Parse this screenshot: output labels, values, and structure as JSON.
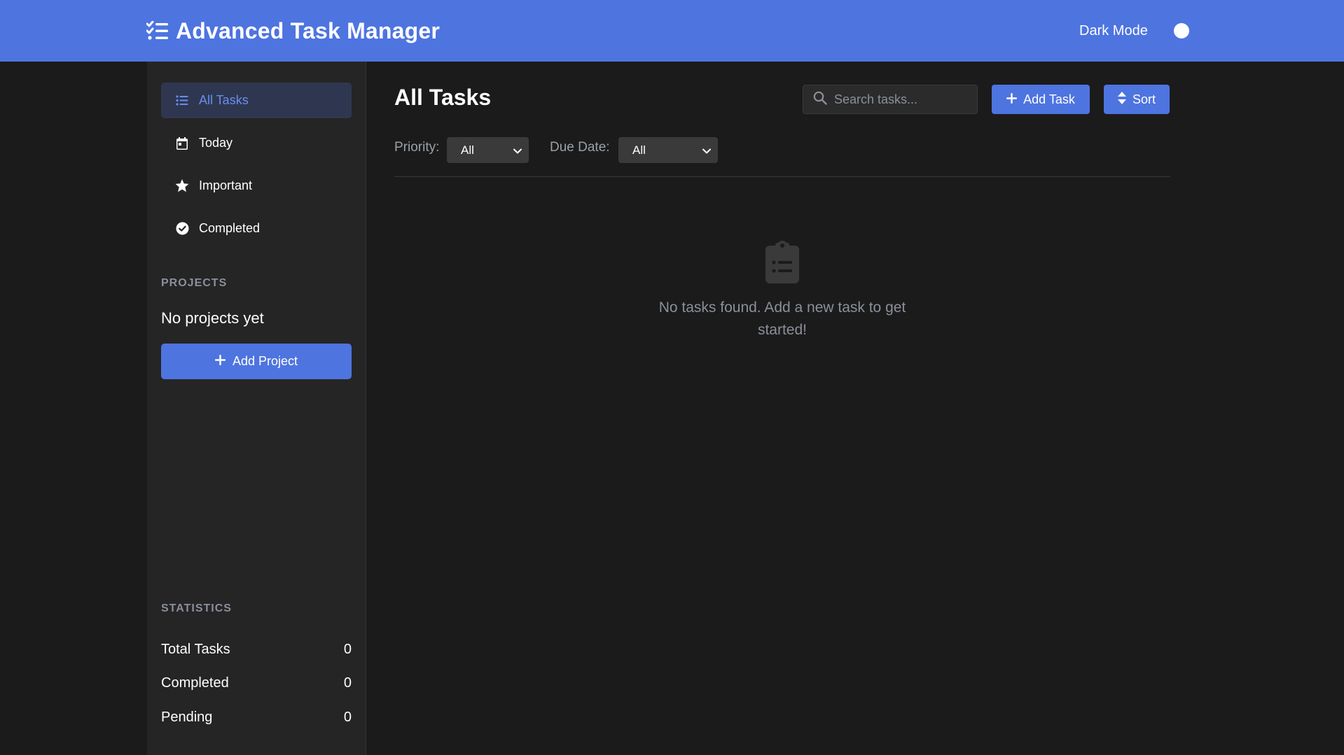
{
  "header": {
    "title": "Advanced Task Manager",
    "dark_mode_label": "Dark Mode",
    "accent_color": "#4e74e0"
  },
  "sidebar": {
    "nav": [
      {
        "label": "All Tasks",
        "icon": "list-icon",
        "active": true
      },
      {
        "label": "Today",
        "icon": "calendar-icon",
        "active": false
      },
      {
        "label": "Important",
        "icon": "star-icon",
        "active": false
      },
      {
        "label": "Completed",
        "icon": "check-circle-icon",
        "active": false
      }
    ],
    "projects_title": "PROJECTS",
    "no_projects": "No projects yet",
    "add_project_label": "Add Project",
    "statistics_title": "STATISTICS",
    "stats": [
      {
        "label": "Total Tasks",
        "value": "0"
      },
      {
        "label": "Completed",
        "value": "0"
      },
      {
        "label": "Pending",
        "value": "0"
      }
    ]
  },
  "main": {
    "title": "All Tasks",
    "search_placeholder": "Search tasks...",
    "add_task_label": "Add Task",
    "sort_label": "Sort",
    "filters": {
      "priority_label": "Priority:",
      "priority_value": "All",
      "due_date_label": "Due Date:",
      "due_date_value": "All"
    },
    "empty_message": "No tasks found. Add a new task to get started!",
    "empty_icon": "clipboard-list-icon"
  }
}
